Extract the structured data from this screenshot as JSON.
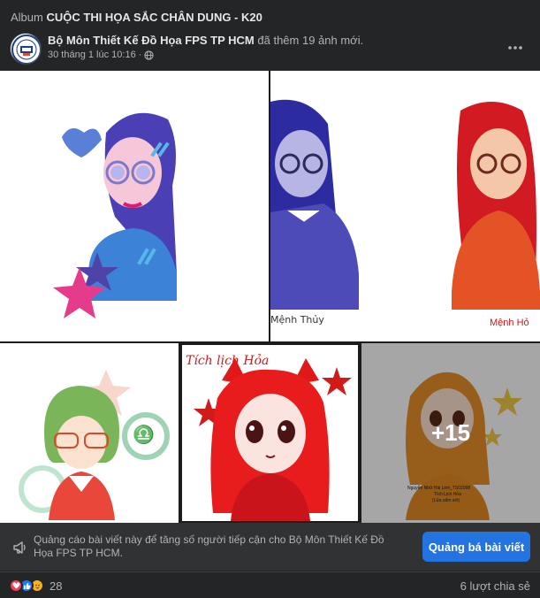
{
  "album": {
    "prefix": "Album",
    "title": "CUỘC THI HỌA SẮC CHÂN DUNG - K20"
  },
  "post": {
    "author": "Bộ Môn Thiết Kế Đồ Họa FPS TP HCM",
    "action": "đã thêm 19 ảnh mới.",
    "timestamp": "30 tháng 1 lúc 10:16",
    "separator": "·",
    "audience_icon": "globe-icon"
  },
  "photos": {
    "top_right_label_left": "Mệnh Thủy",
    "top_right_label_right": "Mệnh Hỏ",
    "middle_title": "Tích lịch Hỏa",
    "more_count": "+15",
    "last_caption_1": "Nguyễn Nhữ Hải Linh_TS02998",
    "last_caption_2": "Tích Lịch Hỏa",
    "last_caption_3": "(Lửa sấm sét)"
  },
  "promo": {
    "icon": "megaphone-icon",
    "text": "Quảng cáo bài viết này để tăng số người tiếp cận cho Bộ Môn Thiết Kế Đồ Họa FPS TP HCM.",
    "button": "Quảng bá bài viết"
  },
  "footer": {
    "reactions": [
      "like",
      "love",
      "care"
    ],
    "reaction_count": "28",
    "shares": "6 lượt chia sẻ"
  },
  "colors": {
    "background": "#242526",
    "accent": "#2374e1",
    "like": "#2078f4",
    "love": "#f33e58",
    "care": "#f7b125"
  }
}
